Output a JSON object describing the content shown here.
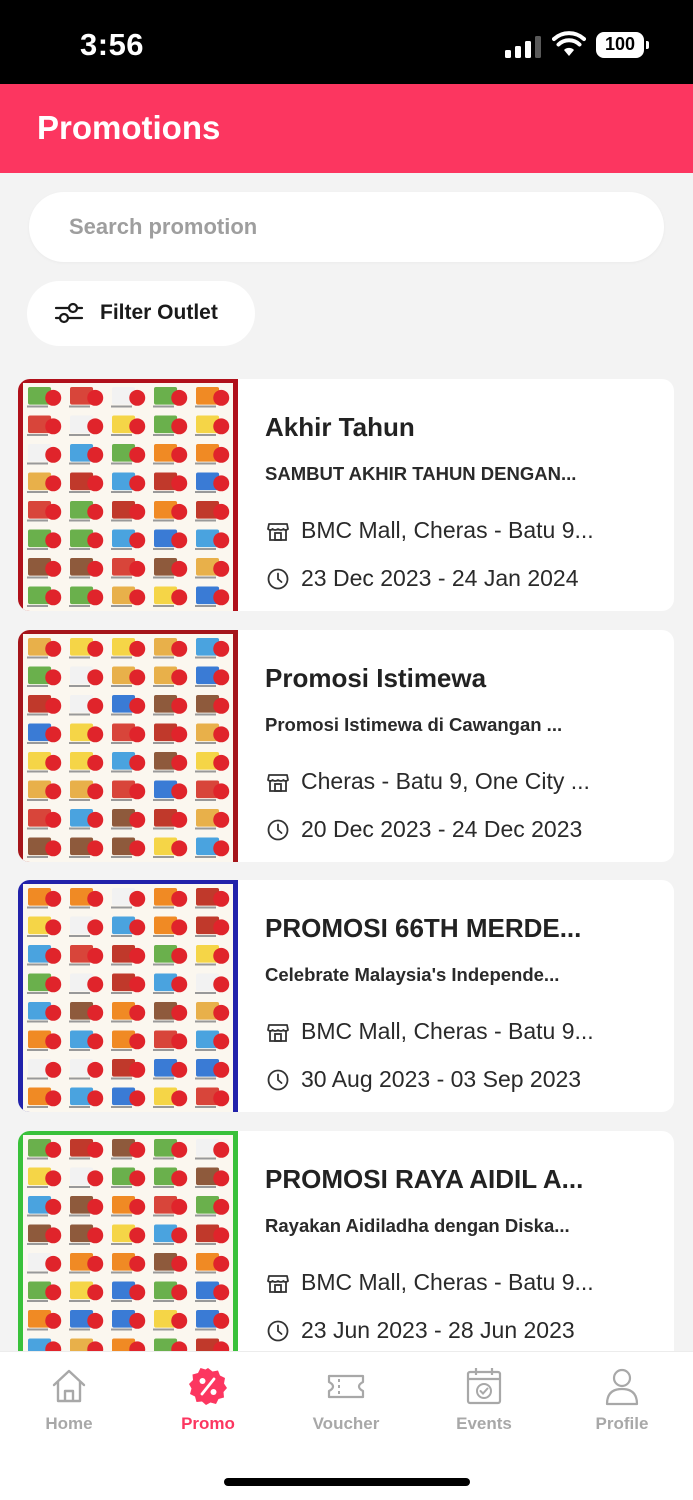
{
  "status_bar": {
    "time": "3:56",
    "battery": "100"
  },
  "header": {
    "title": "Promotions"
  },
  "search": {
    "placeholder": "Search promotion"
  },
  "filter": {
    "label": "Filter Outlet"
  },
  "colors": {
    "accent": "#fc3660",
    "inactive": "#a8a8a8"
  },
  "promotions": [
    {
      "title": "Akhir Tahun",
      "description": "SAMBUT AKHIR TAHUN DENGAN...",
      "outlet": "BMC Mall, Cheras - Batu 9...",
      "date_range": "23 Dec 2023 - 24 Jan 2024",
      "thumb_color": "#b0101a"
    },
    {
      "title": "Promosi Istimewa",
      "description": "Promosi Istimewa di Cawangan ...",
      "outlet": "Cheras - Batu 9, One City ...",
      "date_range": "20 Dec 2023 - 24 Dec 2023",
      "thumb_color": "#a5151a"
    },
    {
      "title": "PROMOSI 66TH MERDE...",
      "description": "Celebrate Malaysia's Independe...",
      "outlet": "BMC Mall, Cheras - Batu 9...",
      "date_range": "30 Aug 2023 - 03 Sep 2023",
      "thumb_color": "#2222aa"
    },
    {
      "title": "PROMOSI RAYA AIDIL A...",
      "description": "Rayakan Aidiladha dengan Diska...",
      "outlet": "BMC Mall, Cheras - Batu 9...",
      "date_range": "23 Jun 2023 - 28 Jun 2023",
      "thumb_color": "#39c13a"
    }
  ],
  "nav": [
    {
      "label": "Home",
      "icon": "home-icon"
    },
    {
      "label": "Promo",
      "icon": "promo-icon",
      "active": true
    },
    {
      "label": "Voucher",
      "icon": "voucher-icon"
    },
    {
      "label": "Events",
      "icon": "events-icon"
    },
    {
      "label": "Profile",
      "icon": "profile-icon"
    }
  ]
}
